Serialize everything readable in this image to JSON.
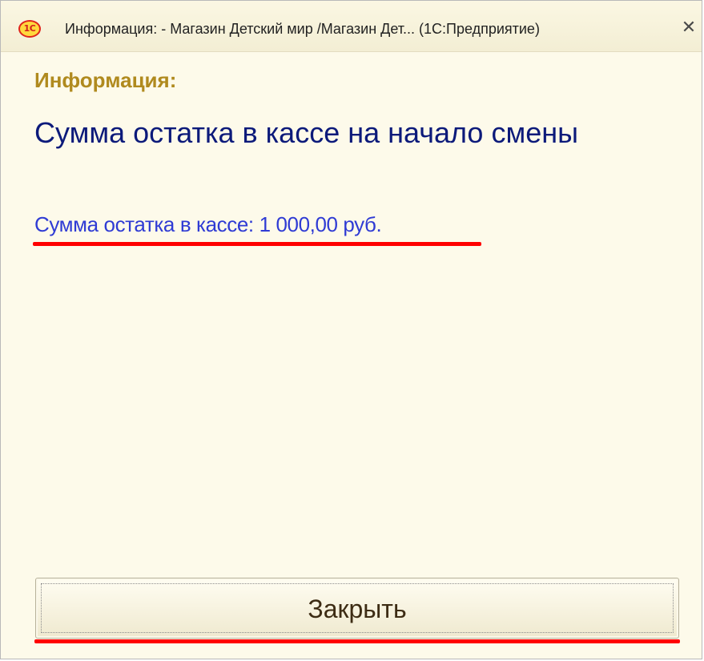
{
  "window": {
    "app_icon_text": "1С",
    "title": "Информация: - Магазин Детский мир /Магазин Дет...  (1С:Предприятие)",
    "close_glyph": "✕"
  },
  "content": {
    "header": "Информация:",
    "message": "Сумма остатка в кассе на начало смены",
    "amount_text": "Сумма остатка в кассе: 1 000,00 руб."
  },
  "footer": {
    "close_button_label": "Закрыть"
  },
  "colors": {
    "background": "#fdfaea",
    "header": "#b08a1e",
    "message": "#0c1a7a",
    "link": "#2f3bd4",
    "annotation_underline": "#ff0000"
  }
}
